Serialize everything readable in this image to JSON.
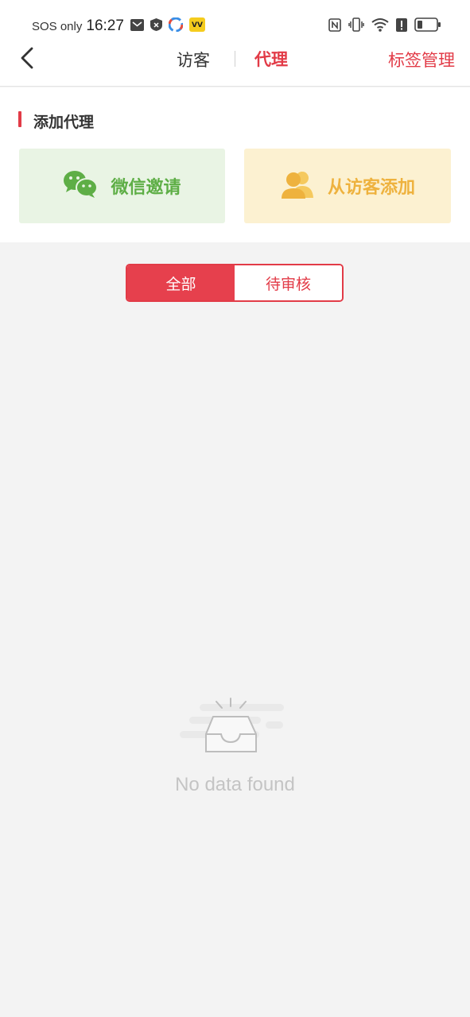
{
  "status_bar": {
    "sos": "SOS only",
    "time": "16:27",
    "icons_left": [
      "mail-icon",
      "shield-icon",
      "app-icon",
      "app-icon-yellow"
    ],
    "icons_right": [
      "nfc-icon",
      "vibrate-icon",
      "wifi-icon",
      "alert-icon",
      "battery-icon"
    ]
  },
  "nav": {
    "tab_visitor": "访客",
    "tab_agent": "代理",
    "tag_manage": "标签管理",
    "active_tab": "代理"
  },
  "add_section": {
    "title": "添加代理",
    "wechat_label": "微信邀请",
    "visitor_label": "从访客添加"
  },
  "filter": {
    "all": "全部",
    "pending": "待审核",
    "active": "全部"
  },
  "empty": {
    "text": "No data found"
  },
  "colors": {
    "accent": "#e23b47",
    "wechat_green": "#5eae46",
    "visitor_yellow": "#eeb23e"
  }
}
